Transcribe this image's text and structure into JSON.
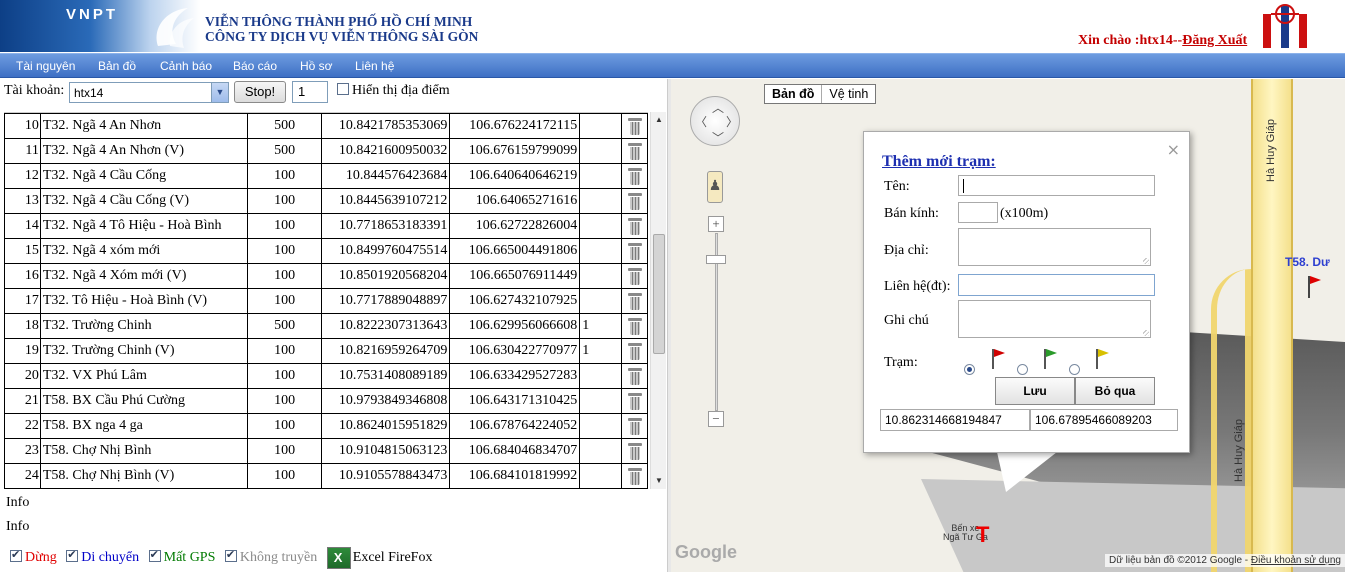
{
  "header": {
    "logo_text": "VNPT",
    "company_line1": "VIỄN THÔNG THÀNH PHỐ HỒ CHÍ MINH",
    "company_line2": "CÔNG TY DỊCH VỤ VIỄN THÔNG SÀI GÒN",
    "greeting": "Xin chào :htx14--",
    "logout": "Đăng Xuất"
  },
  "menu": [
    "Tài nguyên",
    "Bản đồ",
    "Cảnh báo",
    "Báo cáo",
    "Hồ sơ",
    "Liên hệ"
  ],
  "toolbar": {
    "account_label": "Tài khoản:",
    "account_value": "htx14",
    "stop_label": "Stop!",
    "count_value": "1",
    "show_places_label": "Hiển thị địa điểm"
  },
  "table": {
    "rows": [
      {
        "idx": "10",
        "name": "T32. Ngã 4 An Nhơn",
        "radius": "500",
        "lat": "10.8421785353069",
        "lng": "106.676224172115",
        "extra": ""
      },
      {
        "idx": "11",
        "name": "T32. Ngã 4 An Nhơn (V)",
        "radius": "500",
        "lat": "10.8421600950032",
        "lng": "106.676159799099",
        "extra": ""
      },
      {
        "idx": "12",
        "name": "T32. Ngã 4 Cầu Cống",
        "radius": "100",
        "lat": "10.844576423684",
        "lng": "106.640640646219",
        "extra": ""
      },
      {
        "idx": "13",
        "name": "T32. Ngã 4 Cầu Cống (V)",
        "radius": "100",
        "lat": "10.8445639107212",
        "lng": "106.64065271616",
        "extra": ""
      },
      {
        "idx": "14",
        "name": "T32. Ngã 4 Tô Hiệu - Hoà Bình",
        "radius": "100",
        "lat": "10.7718653183391",
        "lng": "106.62722826004",
        "extra": ""
      },
      {
        "idx": "15",
        "name": "T32. Ngã 4 xóm mới",
        "radius": "100",
        "lat": "10.8499760475514",
        "lng": "106.665004491806",
        "extra": ""
      },
      {
        "idx": "16",
        "name": "T32. Ngã 4 Xóm mới (V)",
        "radius": "100",
        "lat": "10.8501920568204",
        "lng": "106.665076911449",
        "extra": ""
      },
      {
        "idx": "17",
        "name": "T32. Tô Hiệu - Hoà Bình (V)",
        "radius": "100",
        "lat": "10.7717889048897",
        "lng": "106.627432107925",
        "extra": ""
      },
      {
        "idx": "18",
        "name": "T32. Trường Chinh",
        "radius": "500",
        "lat": "10.8222307313643",
        "lng": "106.629956066608",
        "extra": "1"
      },
      {
        "idx": "19",
        "name": "T32. Trường Chinh (V)",
        "radius": "100",
        "lat": "10.8216959264709",
        "lng": "106.630422770977",
        "extra": "1"
      },
      {
        "idx": "20",
        "name": "T32. VX Phú Lâm",
        "radius": "100",
        "lat": "10.7531408089189",
        "lng": "106.633429527283",
        "extra": ""
      },
      {
        "idx": "21",
        "name": "T58. BX Cầu Phú Cường",
        "radius": "100",
        "lat": "10.9793849346808",
        "lng": "106.643171310425",
        "extra": ""
      },
      {
        "idx": "22",
        "name": "T58. BX nga 4 ga",
        "radius": "100",
        "lat": "10.8624015951829",
        "lng": "106.678764224052",
        "extra": ""
      },
      {
        "idx": "23",
        "name": "T58. Chợ Nhị Bình",
        "radius": "100",
        "lat": "10.9104815063123",
        "lng": "106.684046834707",
        "extra": ""
      },
      {
        "idx": "24",
        "name": "T58. Chợ Nhị Bình (V)",
        "radius": "100",
        "lat": "10.9105578843473",
        "lng": "106.684101819992",
        "extra": ""
      }
    ]
  },
  "info": [
    "Info",
    "Info"
  ],
  "legend": [
    {
      "label": "Dừng",
      "color": "#e00000"
    },
    {
      "label": "Di chuyển",
      "color": "#0000c8"
    },
    {
      "label": "Mất GPS",
      "color": "#007a00"
    },
    {
      "label": "Không truyền",
      "color": "#8a8a8a"
    }
  ],
  "excel_label": "Excel FireFox",
  "map": {
    "type_map": "Bản đồ",
    "type_satellite": "Vệ tinh",
    "road_name": "Hà Huy Giáp",
    "station_label": "T58. Dư",
    "busstop_line1": "Bến xe",
    "busstop_line2": "Ngã Tư Ga",
    "google": "Google",
    "copyright": "Dữ liệu bản đồ ©2012 Google - ",
    "terms": "Điều khoản sử dụng"
  },
  "popup": {
    "title": "Thêm mới trạm:",
    "name_label": "Tên:",
    "radius_label": "Bán kính:",
    "radius_unit": "(x100m)",
    "address_label": "Địa chỉ:",
    "contact_label": "Liên hệ(đt):",
    "note_label": "Ghi chú",
    "station_label": "Trạm:",
    "flag_colors": [
      "#d00000",
      "#2a9a2a",
      "#d8c000"
    ],
    "save": "Lưu",
    "skip": "Bỏ qua",
    "lat": "10.862314668194847",
    "lng": "106.67895466089203"
  }
}
